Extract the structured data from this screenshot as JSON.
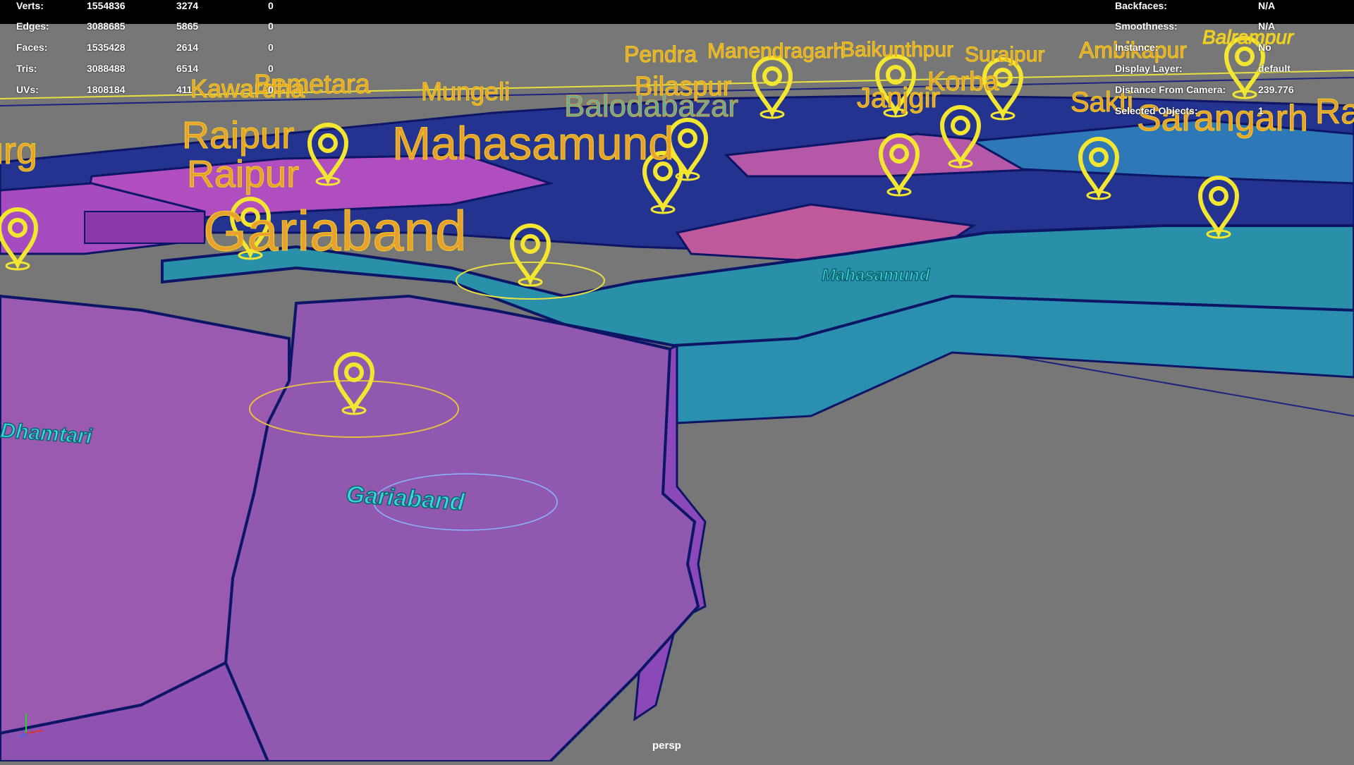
{
  "viewport": {
    "camera": "persp"
  },
  "hud_left": {
    "rows": [
      {
        "label": "Verts:",
        "total": "1554836",
        "selected": "3274",
        "uv": "0"
      },
      {
        "label": "Edges:",
        "total": "3088685",
        "selected": "5865",
        "uv": "0"
      },
      {
        "label": "Faces:",
        "total": "1535428",
        "selected": "2614",
        "uv": "0"
      },
      {
        "label": "Tris:",
        "total": "3088488",
        "selected": "6514",
        "uv": "0"
      },
      {
        "label": "UVs:",
        "total": "1808184",
        "selected": "411",
        "uv": "0"
      }
    ]
  },
  "hud_right": {
    "rows": [
      {
        "label": "Backfaces:",
        "value": "N/A"
      },
      {
        "label": "Smoothness:",
        "value": "N/A"
      },
      {
        "label": "Instance:",
        "value": "No"
      },
      {
        "label": "Display Layer:",
        "value": "default"
      },
      {
        "label": "Distance From Camera:",
        "value": "239.776"
      },
      {
        "label": "Selected Objects:",
        "value": "1"
      }
    ]
  },
  "map_labels": {
    "pendra": "Pendra",
    "manendragarh": "Manendragarh",
    "baikunthpur": "Baikunthpur",
    "surajpur": "Surajpur",
    "ambikapur": "Ambikapur",
    "balrampur": "Balrampur",
    "kawardha": "Kawardha",
    "bemetara": "Bemetara",
    "mungeli": "Mungeli",
    "bilaspur": "Bilaspur",
    "korba": "Korba",
    "janjgir": "Janjgir",
    "balodabazar": "Balodabazar",
    "sakti": "Sakti",
    "sarangarh": "Sarangarh",
    "raigarh_partial": "Ra",
    "raipur1": "Raipur",
    "raipur2": "Raipur",
    "durg_partial": "urg",
    "mahasamund": "Mahasamund",
    "gariaband": "Gariaband"
  },
  "ground_labels": {
    "gariaband": "Gariaband",
    "dhamtari": "Dhamtari",
    "mahasamund": "Mahasamund"
  },
  "colors": {
    "background": "#777777",
    "purple": "#9158b0",
    "teal": "#2a8fa8",
    "magenta": "#b050b8",
    "navy": "#1a237e",
    "label_orange": "#e07a3a",
    "label_yellow": "#f0d020",
    "pin_yellow": "#f2e630",
    "ground_cyan": "#39d8d8"
  }
}
